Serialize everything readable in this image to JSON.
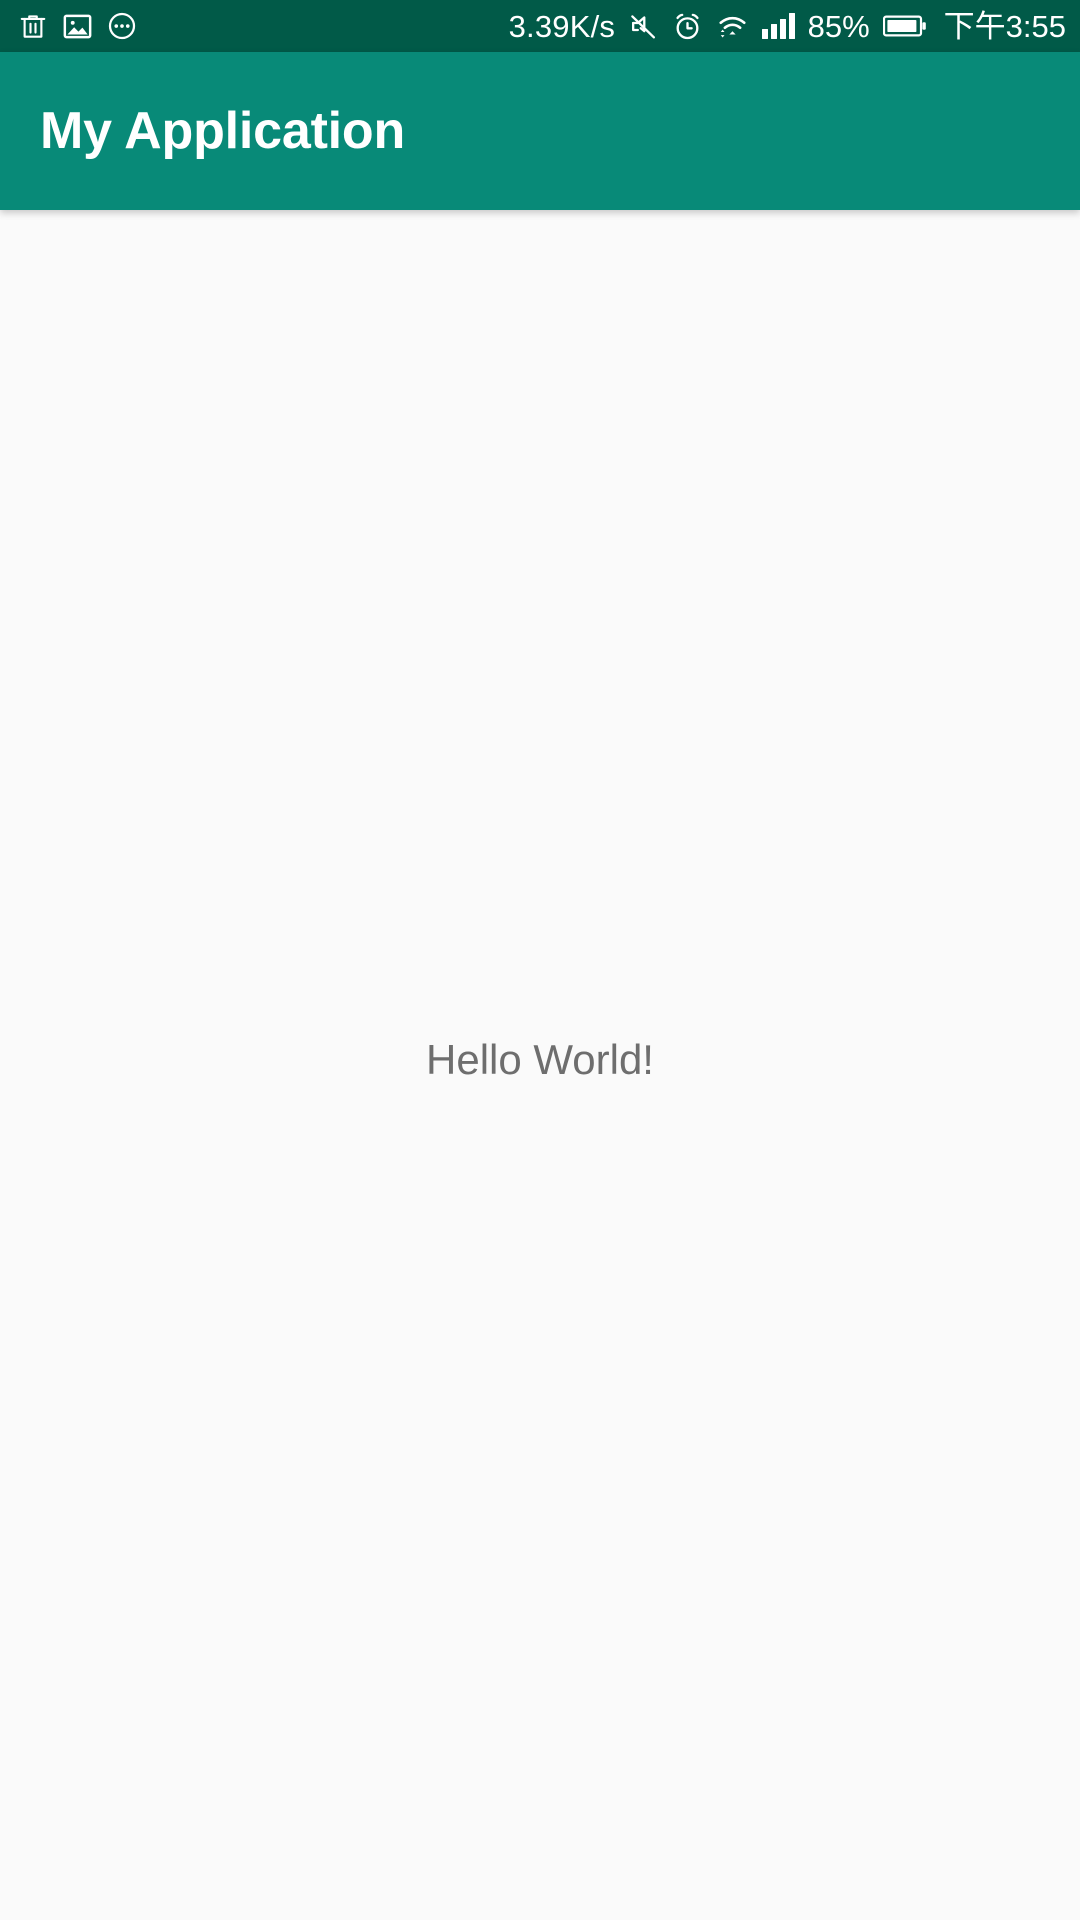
{
  "status_bar": {
    "background_color": "#015a48",
    "foreground_color": "#ffffff",
    "left_icons": [
      {
        "name": "trash-icon",
        "label": "delete"
      },
      {
        "name": "image-icon",
        "label": "screenshot"
      },
      {
        "name": "more-options-icon",
        "label": "more"
      }
    ],
    "network_speed": "3.39K/s",
    "right_icons": [
      {
        "name": "mute-icon",
        "label": "silent mode"
      },
      {
        "name": "alarm-clock-icon",
        "label": "alarm"
      },
      {
        "name": "wifi-icon",
        "label": "wifi"
      },
      {
        "name": "cellular-signal-icon",
        "label": "signal",
        "bars": 4
      }
    ],
    "battery_percent": "85%",
    "battery_icon": "battery-icon",
    "time": "下午3:55"
  },
  "app_bar": {
    "title": "My Application",
    "background_color": "#088a78",
    "title_color": "#ffffff"
  },
  "content": {
    "background_color": "#fafafa",
    "hello_text": "Hello World!",
    "hello_text_color": "#6e6e6e"
  }
}
